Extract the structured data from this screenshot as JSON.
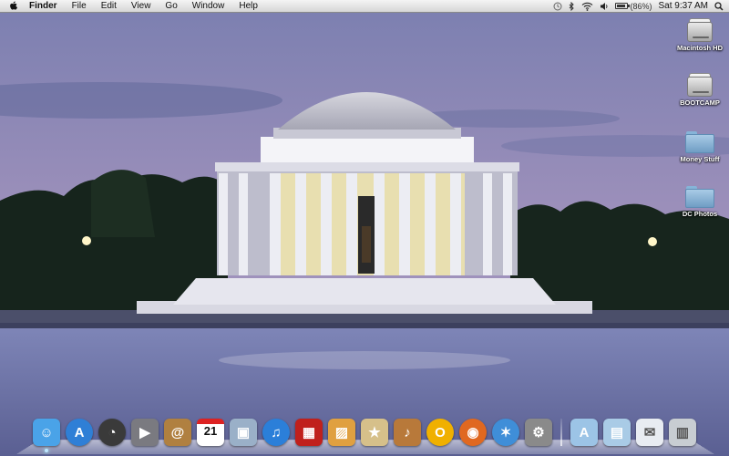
{
  "menubar": {
    "apple_icon": "apple-logo-icon",
    "app_name": "Finder",
    "menus": [
      "File",
      "Edit",
      "View",
      "Go",
      "Window",
      "Help"
    ],
    "status": {
      "time_machine_icon": "time-machine-icon",
      "bluetooth_icon": "bluetooth-icon",
      "wifi_icon": "wifi-icon",
      "volume_icon": "volume-icon",
      "battery_percent_text": "(86%)",
      "battery_level": 0.86,
      "clock": "Sat 9:37 AM",
      "spotlight_icon": "spotlight-search-icon"
    }
  },
  "desktop": {
    "icons": [
      {
        "label": "Macintosh HD",
        "kind": "hard-drive-icon"
      },
      {
        "label": "BOOTCAMP",
        "kind": "hard-drive-icon"
      },
      {
        "label": "Money Stuff",
        "kind": "folder-icon"
      },
      {
        "label": "DC Photos",
        "kind": "folder-icon"
      }
    ]
  },
  "dock": {
    "apps": [
      {
        "name": "Finder",
        "icon": "finder-icon",
        "color": "#4aa3e8",
        "running": true
      },
      {
        "name": "App Store",
        "icon": "app-store-icon",
        "color": "#2f7fd6",
        "running": false
      },
      {
        "name": "Dashboard",
        "icon": "dashboard-icon",
        "color": "#3a3a3a",
        "running": false
      },
      {
        "name": "FaceTime",
        "icon": "facetime-icon",
        "color": "#7a7a80",
        "running": false
      },
      {
        "name": "Address Book",
        "icon": "address-book-icon",
        "color": "#b08040",
        "running": false
      },
      {
        "name": "iCal",
        "icon": "ical-icon",
        "color": "#ffffff",
        "calendar_day": "21",
        "running": false
      },
      {
        "name": "Preview",
        "icon": "preview-icon",
        "color": "#9ab0c8",
        "running": false
      },
      {
        "name": "iTunes",
        "icon": "itunes-icon",
        "color": "#2b7fd9",
        "running": false
      },
      {
        "name": "Photo Booth",
        "icon": "photo-booth-icon",
        "color": "#c0201c",
        "running": false
      },
      {
        "name": "iPhoto",
        "icon": "iphoto-icon",
        "color": "#e0a040",
        "running": false
      },
      {
        "name": "iMovie",
        "icon": "imovie-icon",
        "color": "#d6c08a",
        "running": false
      },
      {
        "name": "GarageBand",
        "icon": "garageband-icon",
        "color": "#b8793a",
        "running": false
      },
      {
        "name": "Opera",
        "icon": "opera-icon",
        "color": "#f0b000",
        "running": false
      },
      {
        "name": "Firefox",
        "icon": "firefox-icon",
        "color": "#e06820",
        "running": false
      },
      {
        "name": "Safari",
        "icon": "safari-icon",
        "color": "#3f8ed8",
        "running": false
      },
      {
        "name": "System Preferences",
        "icon": "system-preferences-icon",
        "color": "#8a8a8a",
        "running": false
      }
    ],
    "stacks": [
      {
        "name": "Applications",
        "icon": "applications-folder-icon",
        "color": "#9cc4e6"
      },
      {
        "name": "Documents",
        "icon": "documents-folder-icon",
        "color": "#a9cbe6"
      },
      {
        "name": "Mail",
        "icon": "mail-icon",
        "color": "#e8ecf2"
      },
      {
        "name": "Trash",
        "icon": "trash-icon",
        "color": "#c8cdd2"
      }
    ]
  }
}
